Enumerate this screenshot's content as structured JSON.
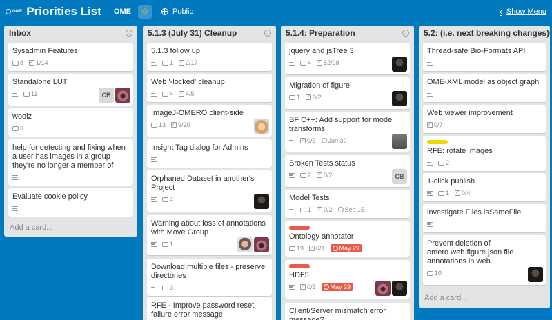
{
  "header": {
    "logo_text": "OME",
    "board_title": "Priorities List",
    "org": "OME",
    "visibility": "Public",
    "show_menu": "Show Menu",
    "colors": {
      "background": "#0079bf",
      "star": "#f2d600"
    }
  },
  "colors": {
    "label_red": "#eb5a46",
    "label_yellow": "#f2d600",
    "due_badge": "#eb5a46"
  },
  "lists": [
    {
      "title": "Inbox",
      "add_card": "Add a card...",
      "cards": [
        {
          "title": "Sysadmin Features",
          "comments": "8",
          "checklist": "1/14"
        },
        {
          "title": "Standalone LUT",
          "comments": "11",
          "members": [
            "CB"
          ]
        },
        {
          "title": "woolz",
          "comments": "3"
        },
        {
          "title": "help for detecting and fixing when a user has images in a group they're no longer a member of"
        },
        {
          "title": "Evaluate cookie policy"
        }
      ]
    },
    {
      "title": "5.1.3 (July 31) Cleanup",
      "cards": [
        {
          "title": "5.1.3 follow up",
          "comments": "1",
          "checklist": "2/17"
        },
        {
          "title": "Web '-locked' cleanup",
          "comments": "4",
          "checklist": "4/5"
        },
        {
          "title": "ImageJ-OMERO client-side",
          "comments": "13",
          "checklist": "9/20"
        },
        {
          "title": "Insight Tag dialog for Admins"
        },
        {
          "title": "Orphaned Dataset in another's Project",
          "comments": "4"
        },
        {
          "title": "Warning about loss of annotations with Move Group",
          "comments": "1"
        },
        {
          "title": "Download multiple files - preserve directories",
          "comments": "3"
        },
        {
          "title": "RFE - Improve password reset failure error message"
        }
      ]
    },
    {
      "title": "5.1.4: Preparation",
      "cards": [
        {
          "title": "jquery and jsTree 3",
          "comments": "4",
          "checklist": "52/98"
        },
        {
          "title": "Migration of figure",
          "comments": "1",
          "checklist": "0/2"
        },
        {
          "title": "BF C++: Add support for model transforms",
          "checklist": "0/3",
          "due": "Jun 30"
        },
        {
          "title": "Broken Tests status",
          "comments": "2",
          "checklist": "0/2",
          "members": [
            "CB"
          ]
        },
        {
          "title": "Model Tests",
          "comments": "1",
          "checklist": "0/2",
          "due": "Sep 15"
        },
        {
          "title": "Ontology annotator",
          "comments": "19",
          "checklist": "0/1",
          "due": "May 29"
        },
        {
          "title": "HDF5",
          "checklist": "0/3",
          "due": "May 29"
        },
        {
          "title": "Client/Server mismatch error message?"
        }
      ]
    },
    {
      "title": "5.2: (i.e. next breaking changes)",
      "add_card": "Add a card...",
      "cards": [
        {
          "title": "Thread-safe Bio-Formats API"
        },
        {
          "title": "OME-XML model as object graph"
        },
        {
          "title": "Web viewer improvement",
          "checklist": "0/7"
        },
        {
          "title": "RFE: rotate images",
          "comments": "2"
        },
        {
          "title": "1-click publish",
          "comments": "1",
          "checklist": "0/4"
        },
        {
          "title": "investigate Files.isSameFile"
        },
        {
          "title": "Prevent deletion of omero.web.figure.json file annotations in web.",
          "comments": "10"
        }
      ]
    }
  ]
}
